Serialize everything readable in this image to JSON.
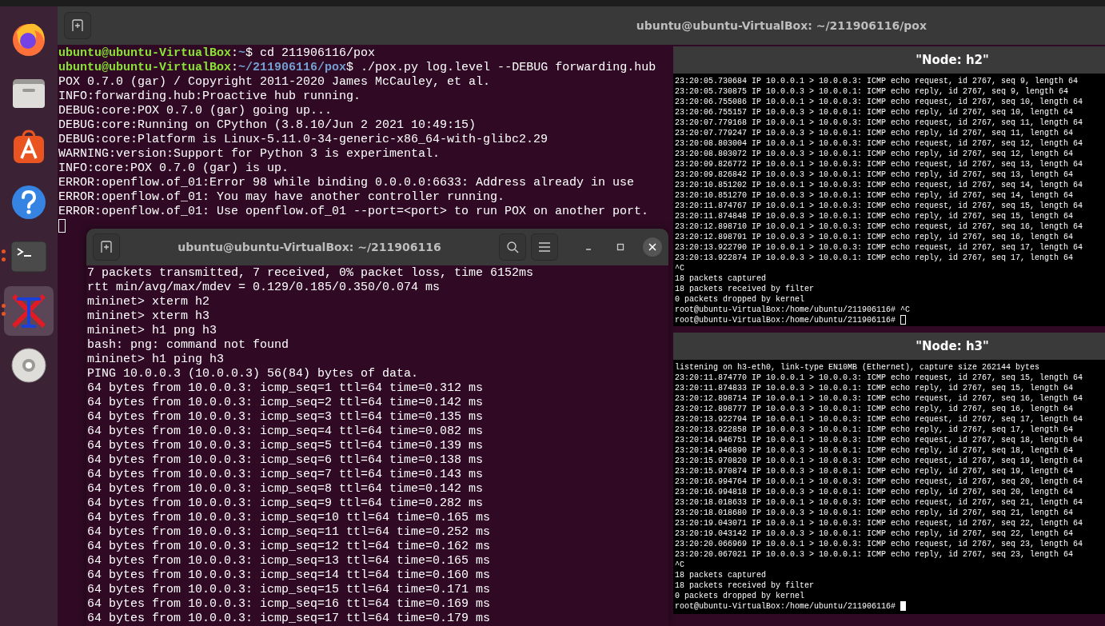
{
  "dock": {
    "items": [
      {
        "kind": "browser",
        "running": false,
        "selected": false
      },
      {
        "kind": "files",
        "running": false,
        "selected": false
      },
      {
        "kind": "store",
        "running": false,
        "selected": false
      },
      {
        "kind": "help",
        "running": false,
        "selected": false
      },
      {
        "kind": "terminal",
        "running": true,
        "selected": false
      },
      {
        "kind": "xterm",
        "running": true,
        "selected": true
      },
      {
        "kind": "disc",
        "running": false,
        "selected": false
      }
    ]
  },
  "main_terminal": {
    "title": "ubuntu@ubuntu-VirtualBox: ~/211906116/pox",
    "focused": false,
    "lines": [
      {
        "kind": "prompt",
        "user": "ubuntu@ubuntu-VirtualBox",
        "separator": ":",
        "path": "~",
        "command": "$ cd 211906116/pox"
      },
      {
        "kind": "prompt",
        "user": "ubuntu@ubuntu-VirtualBox",
        "separator": ":",
        "path": "~/211906116/pox",
        "command": "$ ./pox.py log.level --DEBUG forwarding.hub"
      },
      {
        "kind": "output",
        "text": "POX 0.7.0 (gar) / Copyright 2011-2020 James McCauley, et al."
      },
      {
        "kind": "output",
        "text": "INFO:forwarding.hub:Proactive hub running."
      },
      {
        "kind": "output",
        "text": "DEBUG:core:POX 0.7.0 (gar) going up..."
      },
      {
        "kind": "output",
        "text": "DEBUG:core:Running on CPython (3.8.10/Jun 2 2021 10:49:15)"
      },
      {
        "kind": "output",
        "text": "DEBUG:core:Platform is Linux-5.11.0-34-generic-x86_64-with-glibc2.29"
      },
      {
        "kind": "output",
        "text": "WARNING:version:Support for Python 3 is experimental."
      },
      {
        "kind": "output",
        "text": "INFO:core:POX 0.7.0 (gar) is up."
      },
      {
        "kind": "output",
        "text": "ERROR:openflow.of_01:Error 98 while binding 0.0.0.0:6633: Address already in use"
      },
      {
        "kind": "output",
        "text": "ERROR:openflow.of_01: You may have another controller running."
      },
      {
        "kind": "output",
        "text": "ERROR:openflow.of_01: Use openflow.of_01 --port=<port> to run POX on another port."
      }
    ]
  },
  "mininet_terminal": {
    "title": "ubuntu@ubuntu-VirtualBox: ~/211906116",
    "lines": [
      "7 packets transmitted, 7 received, 0% packet loss, time 6152ms",
      "rtt min/avg/max/mdev = 0.129/0.185/0.350/0.074 ms",
      "mininet> xterm h2",
      "mininet> xterm h3",
      "mininet> h1 png h3",
      "bash: png: command not found",
      "mininet> h1 ping h3",
      "PING 10.0.0.3 (10.0.0.3) 56(84) bytes of data.",
      "64 bytes from 10.0.0.3: icmp_seq=1 ttl=64 time=0.312 ms",
      "64 bytes from 10.0.0.3: icmp_seq=2 ttl=64 time=0.142 ms",
      "64 bytes from 10.0.0.3: icmp_seq=3 ttl=64 time=0.135 ms",
      "64 bytes from 10.0.0.3: icmp_seq=4 ttl=64 time=0.082 ms",
      "64 bytes from 10.0.0.3: icmp_seq=5 ttl=64 time=0.139 ms",
      "64 bytes from 10.0.0.3: icmp_seq=6 ttl=64 time=0.138 ms",
      "64 bytes from 10.0.0.3: icmp_seq=7 ttl=64 time=0.143 ms",
      "64 bytes from 10.0.0.3: icmp_seq=8 ttl=64 time=0.142 ms",
      "64 bytes from 10.0.0.3: icmp_seq=9 ttl=64 time=0.282 ms",
      "64 bytes from 10.0.0.3: icmp_seq=10 ttl=64 time=0.165 ms",
      "64 bytes from 10.0.0.3: icmp_seq=11 ttl=64 time=0.252 ms",
      "64 bytes from 10.0.0.3: icmp_seq=12 ttl=64 time=0.162 ms",
      "64 bytes from 10.0.0.3: icmp_seq=13 ttl=64 time=0.165 ms",
      "64 bytes from 10.0.0.3: icmp_seq=14 ttl=64 time=0.160 ms",
      "64 bytes from 10.0.0.3: icmp_seq=15 ttl=64 time=0.171 ms",
      "64 bytes from 10.0.0.3: icmp_seq=16 ttl=64 time=0.169 ms",
      "64 bytes from 10.0.0.3: icmp_seq=17 ttl=64 time=0.179 ms"
    ]
  },
  "xterm_h2": {
    "title": "\"Node: h2\"",
    "focused": false,
    "lines": [
      "23:20:05.730684 IP 10.0.0.1 > 10.0.0.3: ICMP echo request, id 2767, seq 9, length 64",
      "23:20:05.730875 IP 10.0.0.3 > 10.0.0.1: ICMP echo reply, id 2767, seq 9, length 64",
      "23:20:06.755086 IP 10.0.0.1 > 10.0.0.3: ICMP echo request, id 2767, seq 10, length 64",
      "23:20:06.755157 IP 10.0.0.3 > 10.0.0.1: ICMP echo reply, id 2767, seq 10, length 64",
      "23:20:07.779168 IP 10.0.0.1 > 10.0.0.3: ICMP echo request, id 2767, seq 11, length 64",
      "23:20:07.779247 IP 10.0.0.3 > 10.0.0.1: ICMP echo reply, id 2767, seq 11, length 64",
      "23:20:08.803004 IP 10.0.0.1 > 10.0.0.3: ICMP echo request, id 2767, seq 12, length 64",
      "23:20:08.803072 IP 10.0.0.3 > 10.0.0.1: ICMP echo reply, id 2767, seq 12, length 64",
      "23:20:09.826772 IP 10.0.0.1 > 10.0.0.3: ICMP echo request, id 2767, seq 13, length 64",
      "23:20:09.826842 IP 10.0.0.3 > 10.0.0.1: ICMP echo reply, id 2767, seq 13, length 64",
      "23:20:10.851202 IP 10.0.0.1 > 10.0.0.3: ICMP echo request, id 2767, seq 14, length 64",
      "23:20:10.851270 IP 10.0.0.3 > 10.0.0.1: ICMP echo reply, id 2767, seq 14, length 64",
      "23:20:11.874767 IP 10.0.0.1 > 10.0.0.3: ICMP echo request, id 2767, seq 15, length 64",
      "23:20:11.874848 IP 10.0.0.3 > 10.0.0.1: ICMP echo reply, id 2767, seq 15, length 64",
      "23:20:12.898710 IP 10.0.0.1 > 10.0.0.3: ICMP echo request, id 2767, seq 16, length 64",
      "23:20:12.898791 IP 10.0.0.3 > 10.0.0.1: ICMP echo reply, id 2767, seq 16, length 64",
      "23:20:13.922790 IP 10.0.0.1 > 10.0.0.3: ICMP echo request, id 2767, seq 17, length 64",
      "23:20:13.922874 IP 10.0.0.3 > 10.0.0.1: ICMP echo reply, id 2767, seq 17, length 64",
      "^C",
      "18 packets captured",
      "18 packets received by filter",
      "0 packets dropped by kernel",
      "root@ubuntu-VirtualBox:/home/ubuntu/211906116# ^C",
      "root@ubuntu-VirtualBox:/home/ubuntu/211906116# "
    ]
  },
  "xterm_h3": {
    "title": "\"Node: h3\"",
    "focused": true,
    "lines": [
      "listening on h3-eth0, link-type EN10MB (Ethernet), capture size 262144 bytes",
      "23:20:11.874770 IP 10.0.0.1 > 10.0.0.3: ICMP echo request, id 2767, seq 15, length 64",
      "23:20:11.874833 IP 10.0.0.3 > 10.0.0.1: ICMP echo reply, id 2767, seq 15, length 64",
      "23:20:12.898714 IP 10.0.0.1 > 10.0.0.3: ICMP echo request, id 2767, seq 16, length 64",
      "23:20:12.898777 IP 10.0.0.3 > 10.0.0.1: ICMP echo reply, id 2767, seq 16, length 64",
      "23:20:13.922794 IP 10.0.0.1 > 10.0.0.3: ICMP echo request, id 2767, seq 17, length 64",
      "23:20:13.922858 IP 10.0.0.3 > 10.0.0.1: ICMP echo reply, id 2767, seq 17, length 64",
      "23:20:14.946751 IP 10.0.0.1 > 10.0.0.3: ICMP echo request, id 2767, seq 18, length 64",
      "23:20:14.946890 IP 10.0.0.3 > 10.0.0.1: ICMP echo reply, id 2767, seq 18, length 64",
      "23:20:15.970820 IP 10.0.0.1 > 10.0.0.3: ICMP echo request, id 2767, seq 19, length 64",
      "23:20:15.970874 IP 10.0.0.3 > 10.0.0.1: ICMP echo reply, id 2767, seq 19, length 64",
      "23:20:16.994764 IP 10.0.0.1 > 10.0.0.3: ICMP echo request, id 2767, seq 20, length 64",
      "23:20:16.994818 IP 10.0.0.3 > 10.0.0.1: ICMP echo reply, id 2767, seq 20, length 64",
      "23:20:18.018633 IP 10.0.0.1 > 10.0.0.3: ICMP echo request, id 2767, seq 21, length 64",
      "23:20:18.018680 IP 10.0.0.3 > 10.0.0.1: ICMP echo reply, id 2767, seq 21, length 64",
      "23:20:19.043071 IP 10.0.0.1 > 10.0.0.3: ICMP echo request, id 2767, seq 22, length 64",
      "23:20:19.043142 IP 10.0.0.3 > 10.0.0.1: ICMP echo reply, id 2767, seq 22, length 64",
      "23:20:20.066969 IP 10.0.0.1 > 10.0.0.3: ICMP echo request, id 2767, seq 23, length 64",
      "23:20:20.067021 IP 10.0.0.3 > 10.0.0.1: ICMP echo reply, id 2767, seq 23, length 64",
      "^C",
      "18 packets captured",
      "18 packets received by filter",
      "0 packets dropped by kernel",
      "root@ubuntu-VirtualBox:/home/ubuntu/211906116# "
    ]
  }
}
